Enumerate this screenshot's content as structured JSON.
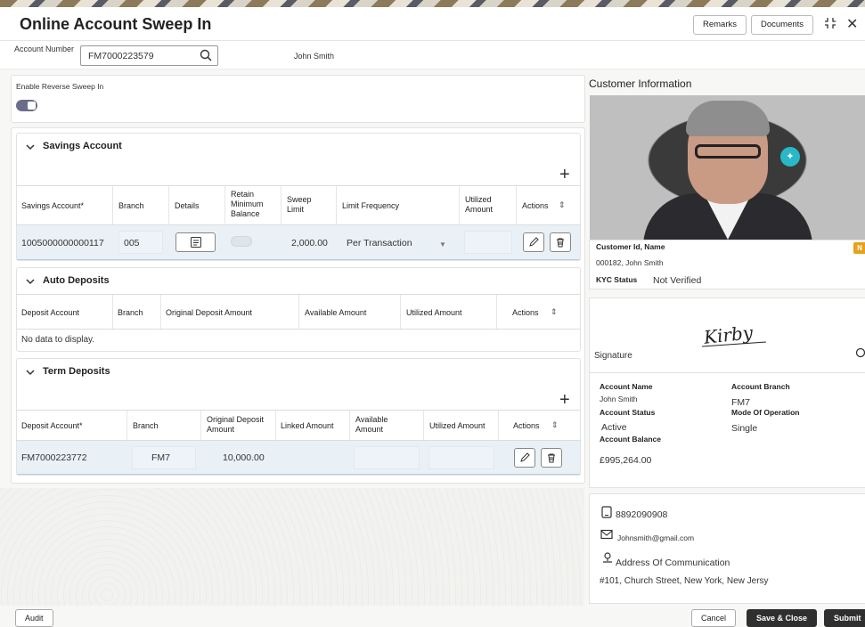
{
  "header": {
    "title": "Online Account Sweep In",
    "remarks_label": "Remarks",
    "documents_label": "Documents"
  },
  "account": {
    "label": "Account Number",
    "value": "FM7000223579",
    "name": "John Smith"
  },
  "reverse_sweep": {
    "label": "Enable Reverse Sweep In",
    "enabled": true
  },
  "savings": {
    "title": "Savings Account",
    "columns": [
      "Savings Account*",
      "Branch",
      "Details",
      "Retain Minimum Balance",
      "Sweep Limit",
      "Limit Frequency",
      "Utilized Amount",
      "Actions"
    ],
    "row": {
      "account": "1005000000000117",
      "branch": "005",
      "sweep_limit": "2,000.00",
      "limit_frequency": "Per Transaction"
    }
  },
  "auto": {
    "title": "Auto Deposits",
    "columns": [
      "Deposit Account",
      "Branch",
      "Original Deposit Amount",
      "Available Amount",
      "Utilized Amount",
      "Actions"
    ],
    "empty": "No data to display."
  },
  "term": {
    "title": "Term Deposits",
    "columns": [
      "Deposit Account*",
      "Branch",
      "Original Deposit Amount",
      "Linked Amount",
      "Available Amount",
      "Utilized Amount",
      "Actions"
    ],
    "row": {
      "account": "FM7000223772",
      "branch": "FM7",
      "original": "10,000.00"
    }
  },
  "customer": {
    "title": "Customer Information",
    "id_label": "Customer Id, Name",
    "id_value": "000182, John Smith",
    "tag": "N",
    "kyc_label": "KYC Status",
    "kyc_value": "Not Verified",
    "signature_label": "Signature",
    "signature_text": "Kirby",
    "account_name_label": "Account Name",
    "account_name": "John Smith",
    "account_branch_label": "Account Branch",
    "account_branch": "FM7",
    "account_status_label": "Account Status",
    "account_status": "Active",
    "mode_label": "Mode Of Operation",
    "mode": "Single",
    "balance_label": "Account Balance",
    "balance": "£995,264.00",
    "phone": "8892090908",
    "email": "Johnsmith@gmail.com",
    "address_label": "Address Of Communication",
    "address": "#101, Church Street, New York, New Jersy"
  },
  "footer": {
    "audit": "Audit",
    "cancel": "Cancel",
    "save_close": "Save & Close",
    "submit": "Submit"
  },
  "icons": [
    "search-icon",
    "minimize-icon",
    "close-icon",
    "chevron-down-icon",
    "plus-icon",
    "edit-icon",
    "delete-icon",
    "sort-icon",
    "details-icon",
    "phone-icon",
    "mail-icon",
    "location-icon",
    "zoom-icon"
  ]
}
